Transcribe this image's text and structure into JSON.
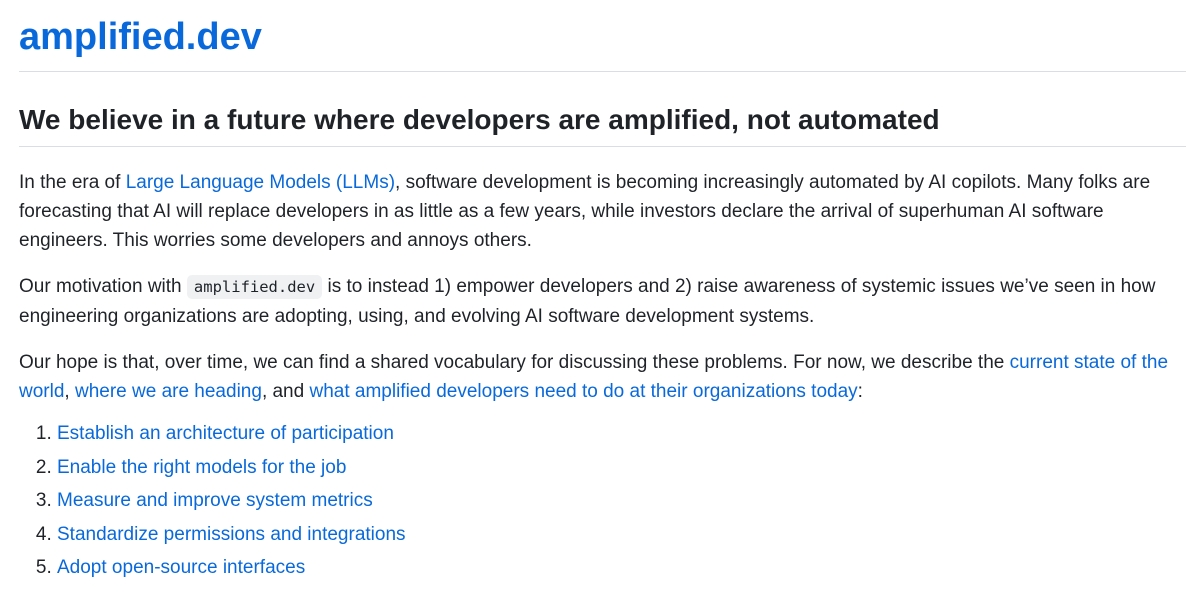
{
  "site": {
    "title": "amplified.dev"
  },
  "headline": "We believe in a future where developers are amplified, not automated",
  "paragraph1": {
    "before_link": "In the era of ",
    "link": "Large Language Models (LLMs)",
    "after_link": ", software development is becoming increasingly automated by AI copilots. Many folks are forecasting that AI will replace developers in as little as a few years, while investors declare the arrival of superhuman AI software engineers. This worries some developers and annoys others."
  },
  "paragraph2": {
    "before_code": "Our motivation with ",
    "code": "amplified.dev",
    "after_code": " is to instead 1) empower developers and 2) raise awareness of systemic issues we’ve seen in how engineering organizations are adopting, using, and evolving AI software development systems."
  },
  "paragraph3": {
    "text1": "Our hope is that, over time, we can find a shared vocabulary for discussing these problems. For now, we describe the ",
    "link1": "current state of the world",
    "text2": ", ",
    "link2": "where we are heading",
    "text3": ", and ",
    "link3": "what amplified developers need to do at their organizations today",
    "text4": ":"
  },
  "list": [
    {
      "label": "Establish an architecture of participation"
    },
    {
      "label": "Enable the right models for the job"
    },
    {
      "label": "Measure and improve system metrics"
    },
    {
      "label": "Standardize permissions and integrations"
    },
    {
      "label": "Adopt open-source interfaces"
    }
  ],
  "colors": {
    "link": "#0969da",
    "text": "#1f2328",
    "divider": "#d8dee4",
    "code_bg": "#eff1f3"
  }
}
